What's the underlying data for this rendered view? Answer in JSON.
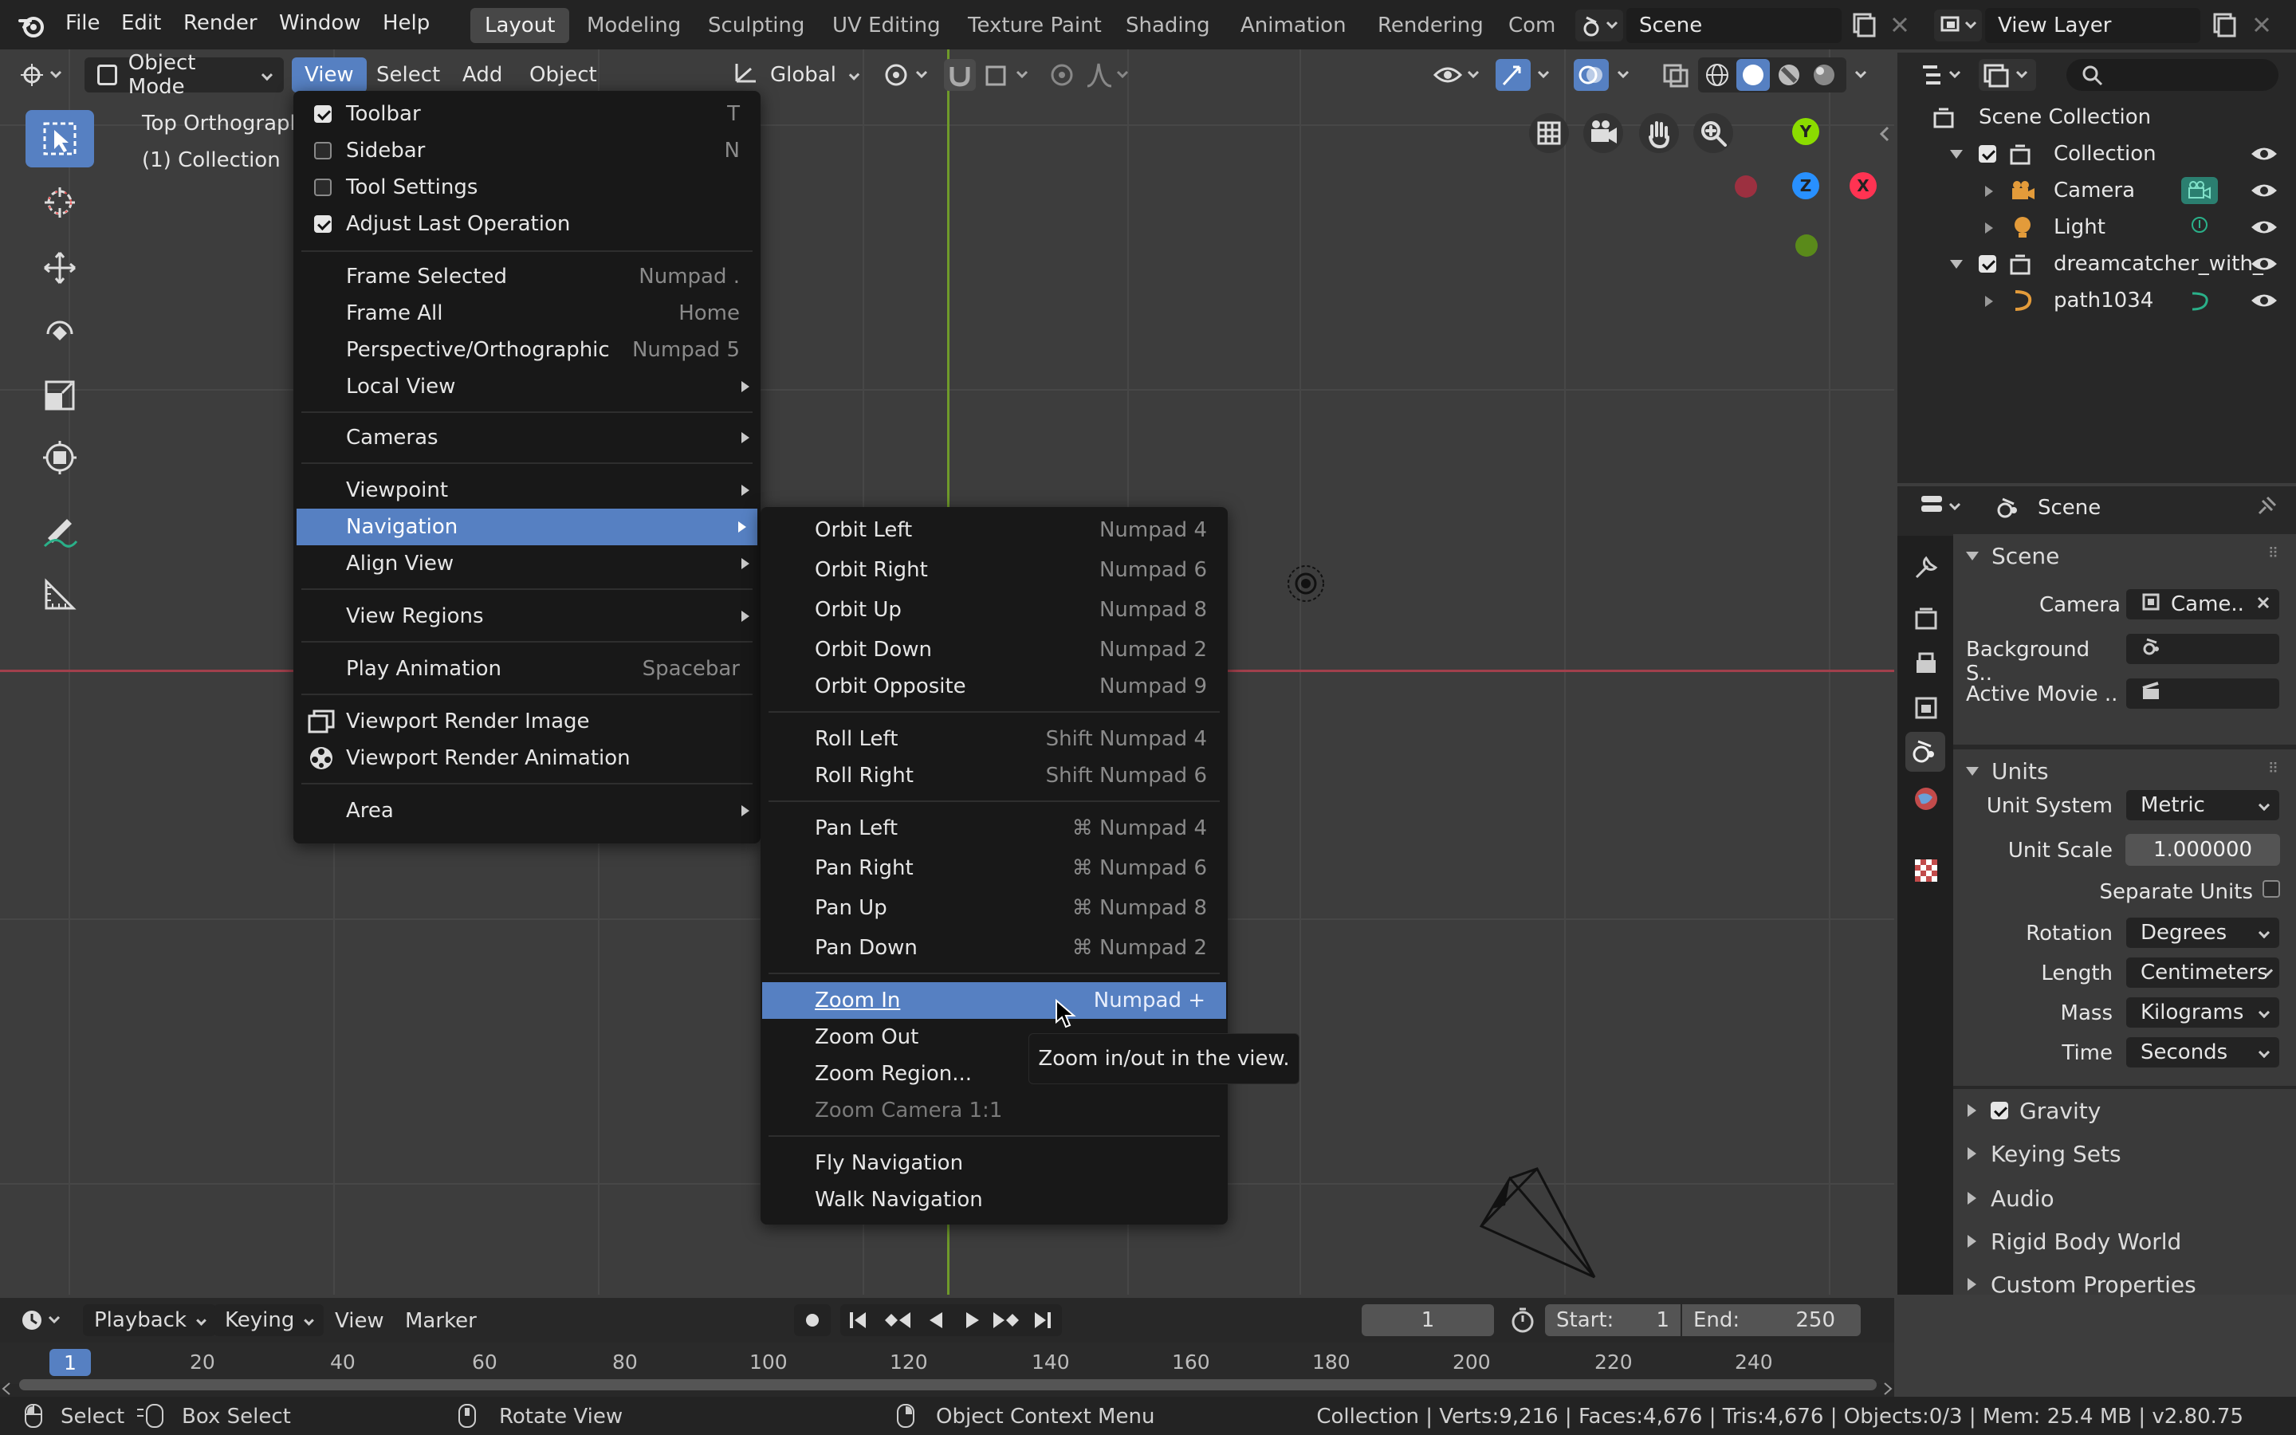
{
  "topbar": {
    "menus": [
      "File",
      "Edit",
      "Render",
      "Window",
      "Help"
    ],
    "workspaces": [
      "Layout",
      "Modeling",
      "Sculpting",
      "UV Editing",
      "Texture Paint",
      "Shading",
      "Animation",
      "Rendering",
      "Com"
    ],
    "active_workspace": "Layout",
    "scene_name": "Scene",
    "view_layer": "View Layer"
  },
  "viewport_header": {
    "mode": "Object Mode",
    "menus": [
      "View",
      "Select",
      "Add",
      "Object"
    ],
    "transform_orientation": "Global"
  },
  "viewport": {
    "view_name": "Top Orthographic",
    "collection_label": "(1) Collection"
  },
  "view_menu": {
    "items": [
      {
        "label": "Toolbar",
        "shortcut": "T",
        "checked": true
      },
      {
        "label": "Sidebar",
        "shortcut": "N",
        "checked": false
      },
      {
        "label": "Tool Settings",
        "shortcut": "",
        "checked": false
      },
      {
        "label": "Adjust Last Operation",
        "shortcut": "",
        "checked": true
      },
      {
        "label": "Frame Selected",
        "shortcut": "Numpad ."
      },
      {
        "label": "Frame All",
        "shortcut": "Home"
      },
      {
        "label": "Perspective/Orthographic",
        "shortcut": "Numpad 5"
      },
      {
        "label": "Local View",
        "shortcut": ""
      },
      {
        "label": "Cameras",
        "shortcut": ""
      },
      {
        "label": "Viewpoint",
        "shortcut": ""
      },
      {
        "label": "Navigation",
        "shortcut": ""
      },
      {
        "label": "Align View",
        "shortcut": ""
      },
      {
        "label": "View Regions",
        "shortcut": ""
      },
      {
        "label": "Play Animation",
        "shortcut": "Spacebar"
      },
      {
        "label": "Viewport Render Image",
        "shortcut": ""
      },
      {
        "label": "Viewport Render Animation",
        "shortcut": ""
      },
      {
        "label": "Area",
        "shortcut": ""
      }
    ]
  },
  "navigation_menu": {
    "items": [
      {
        "label": "Orbit Left",
        "shortcut": "Numpad 4"
      },
      {
        "label": "Orbit Right",
        "shortcut": "Numpad 6"
      },
      {
        "label": "Orbit Up",
        "shortcut": "Numpad 8"
      },
      {
        "label": "Orbit Down",
        "shortcut": "Numpad 2"
      },
      {
        "label": "Orbit Opposite",
        "shortcut": "Numpad 9"
      },
      {
        "label": "Roll Left",
        "shortcut": "Shift Numpad 4"
      },
      {
        "label": "Roll Right",
        "shortcut": "Shift Numpad 6"
      },
      {
        "label": "Pan Left",
        "shortcut": "⌘ Numpad 4"
      },
      {
        "label": "Pan Right",
        "shortcut": "⌘ Numpad 6"
      },
      {
        "label": "Pan Up",
        "shortcut": "⌘ Numpad 8"
      },
      {
        "label": "Pan Down",
        "shortcut": "⌘ Numpad 2"
      },
      {
        "label": "Zoom In",
        "shortcut": "Numpad +"
      },
      {
        "label": "Zoom Out",
        "shortcut": ""
      },
      {
        "label": "Zoom Region...",
        "shortcut": ""
      },
      {
        "label": "Zoom Camera 1:1",
        "shortcut": ""
      },
      {
        "label": "Fly Navigation",
        "shortcut": ""
      },
      {
        "label": "Walk Navigation",
        "shortcut": ""
      }
    ],
    "tooltip": "Zoom in/out in the view."
  },
  "gizmo": {
    "y": "Y",
    "z": "Z",
    "x": "X"
  },
  "outliner": {
    "root": "Scene Collection",
    "rows": [
      "Collection",
      "Camera",
      "Light",
      "dreamcatcher_with_",
      "path1034"
    ]
  },
  "properties": {
    "header": "Scene",
    "scene_section": "Scene",
    "camera_label": "Camera",
    "camera_value": "Came..",
    "background_label": "Background S..",
    "movie_label": "Active Movie ..",
    "units_section": "Units",
    "unit_system_label": "Unit System",
    "unit_system": "Metric",
    "unit_scale_label": "Unit Scale",
    "unit_scale": "1.000000",
    "separate_units_label": "Separate Units",
    "rotation_label": "Rotation",
    "rotation": "Degrees",
    "length_label": "Length",
    "length": "Centimeters",
    "mass_label": "Mass",
    "mass": "Kilograms",
    "time_label": "Time",
    "time": "Seconds",
    "collapsed": [
      "Gravity",
      "Keying Sets",
      "Audio",
      "Rigid Body World",
      "Custom Properties"
    ]
  },
  "timeline": {
    "menus": [
      "Playback",
      "Keying",
      "View",
      "Marker"
    ],
    "current_frame": "1",
    "start_label": "Start:",
    "start": "1",
    "end_label": "End:",
    "end": "250",
    "ticks": [
      "20",
      "40",
      "60",
      "80",
      "100",
      "120",
      "140",
      "160",
      "180",
      "200",
      "220",
      "240"
    ],
    "playhead": "1"
  },
  "statusbar": {
    "select": "Select",
    "box_select": "Box Select",
    "rotate_view": "Rotate View",
    "context_menu": "Object Context Menu",
    "stats": "Collection | Verts:9,216 | Faces:4,676 | Tris:4,676 | Objects:0/3 | Mem: 25.4 MB | v2.80.75"
  },
  "colors": {
    "accent": "#5680c2",
    "axis_x": "#ff3352",
    "axis_y": "#8bdc00",
    "axis_z": "#2890ff"
  }
}
